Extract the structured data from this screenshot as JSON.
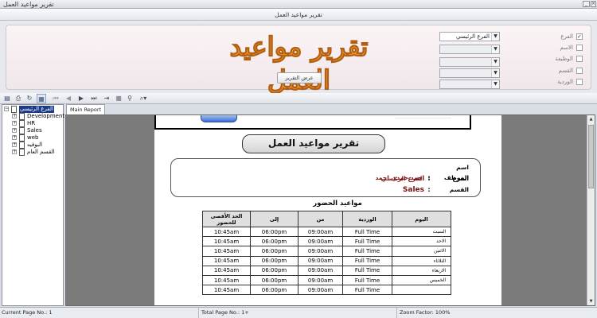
{
  "window": {
    "title": "تقرير مواعيد العمل"
  },
  "panel": {
    "header": "تقرير مواعيد العمل",
    "banner_text": "تقرير مواعيد العمل",
    "show_button": "عرض التقرير",
    "filters": [
      {
        "label": "الفرع",
        "checked": true,
        "value": "الفرع الرئيسي",
        "enabled": true
      },
      {
        "label": "الاسم",
        "checked": false,
        "value": "",
        "enabled": false
      },
      {
        "label": "الوظيفة",
        "checked": false,
        "value": "",
        "enabled": false
      },
      {
        "label": "القسم",
        "checked": false,
        "value": "",
        "enabled": false
      },
      {
        "label": "الوردية",
        "checked": false,
        "value": "",
        "enabled": false
      }
    ]
  },
  "toolbar": {
    "icons": [
      "export-icon",
      "print-icon",
      "refresh-icon",
      "toggle-tree-icon",
      "first-page-icon",
      "prev-page-icon",
      "next-page-icon",
      "last-page-icon",
      "goto-page-icon",
      "stop-icon",
      "search-icon",
      "zoom-icon"
    ]
  },
  "tree": {
    "root": "الفرع الرئيسي",
    "children": [
      "Development",
      "HR",
      "Sales",
      "web",
      "البوفيه",
      "القسم العام"
    ]
  },
  "tabs": {
    "main": "Main Report"
  },
  "report": {
    "title": "تقرير مواعيد العمل",
    "employee_label": "اسم الموظف",
    "employee_value": "احمد حمدي احمد",
    "branch_label": "الفرع",
    "branch_value": "الفرع الرئيسي",
    "dept_label": "القسم",
    "dept_value": "Sales",
    "separator": ":",
    "schedule_title": "مواعيد الحضور",
    "columns": [
      "الحد الأقصى للحضور",
      "إلى",
      "من",
      "الوردية",
      "اليوم"
    ],
    "rows": [
      {
        "max": "10:45am",
        "to": "06:00pm",
        "from": "09:00am",
        "shift": "Full Time",
        "day": "السبت"
      },
      {
        "max": "10:45am",
        "to": "06:00pm",
        "from": "09:00am",
        "shift": "Full Time",
        "day": "الاحد"
      },
      {
        "max": "10:45am",
        "to": "06:00pm",
        "from": "09:00am",
        "shift": "Full Time",
        "day": "الاثنين"
      },
      {
        "max": "10:45am",
        "to": "06:00pm",
        "from": "09:00am",
        "shift": "Full Time",
        "day": "الثلاثاء"
      },
      {
        "max": "10:45am",
        "to": "06:00pm",
        "from": "09:00am",
        "shift": "Full Time",
        "day": "الاربعاء"
      },
      {
        "max": "10:45am",
        "to": "06:00pm",
        "from": "09:00am",
        "shift": "Full Time",
        "day": "الخميس"
      },
      {
        "max": "10:45am",
        "to": "06:00pm",
        "from": "09:00am",
        "shift": "Full Time",
        "day": ""
      }
    ]
  },
  "status": {
    "current_page": "Current Page No.: 1",
    "total_page": "Total Page No.: 1+",
    "zoom": "Zoom Factor: 100%"
  }
}
